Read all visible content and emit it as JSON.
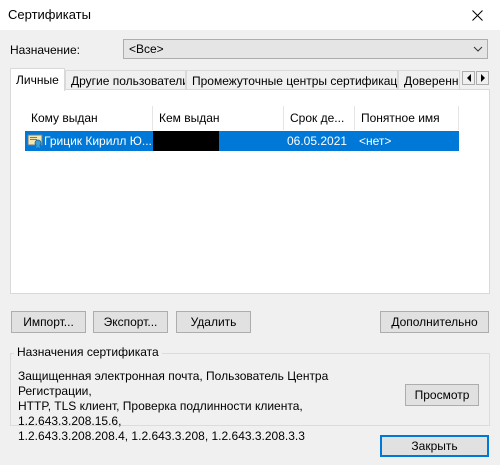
{
  "window": {
    "title": "Сертификаты"
  },
  "purpose": {
    "label": "Назначение:",
    "selected": "<Все>"
  },
  "tabs": [
    {
      "label": "Личные",
      "active": true
    },
    {
      "label": "Другие пользователи",
      "active": false
    },
    {
      "label": "Промежуточные центры сертификации",
      "active": false
    },
    {
      "label": "Доверенн",
      "active": false
    }
  ],
  "table": {
    "columns": [
      "Кому выдан",
      "Кем выдан",
      "Срок де...",
      "Понятное имя"
    ],
    "rows": [
      {
        "issued_to": "Грицик Кирилл Ю...",
        "issued_by": "",
        "expiry": "06.05.2021",
        "friendly_name": "<нет>",
        "selected": true
      }
    ]
  },
  "buttons": {
    "import": "Импорт...",
    "export": "Экспорт...",
    "remove": "Удалить",
    "advanced": "Дополнительно",
    "view": "Просмотр",
    "close": "Закрыть"
  },
  "cert_purposes": {
    "title": "Назначения сертификата",
    "lines": [
      "Защищенная электронная почта, Пользователь Центра Регистрации,",
      "HTTP, TLS клиент, Проверка подлинности клиента, 1.2.643.3.208.15.6,",
      "1.2.643.3.208.208.4, 1.2.643.3.208, 1.2.643.3.208.3.3"
    ]
  },
  "colors": {
    "selection": "#0078d7",
    "window_bg": "#f0f0f0",
    "default_button_border": "#0078d7"
  },
  "icons": [
    "close-icon",
    "chevron-down-icon",
    "chevron-left-icon",
    "chevron-right-icon",
    "certificate-icon"
  ]
}
